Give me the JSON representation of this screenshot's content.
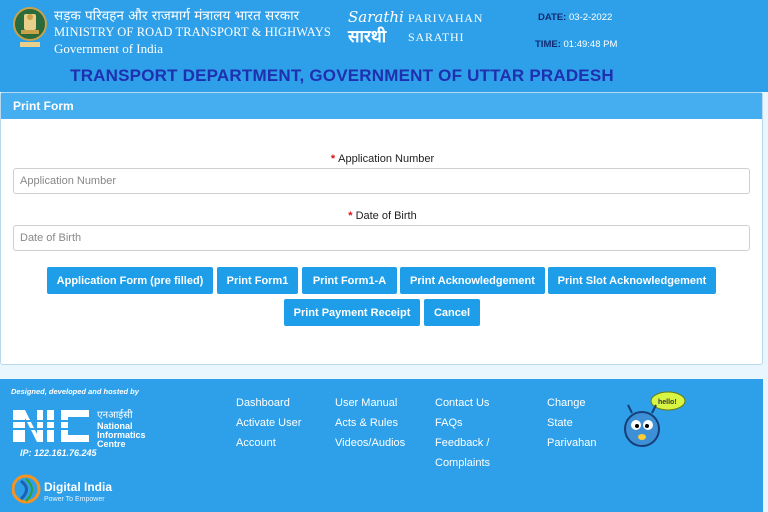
{
  "header": {
    "ministry_hindi": "सड़क परिवहन और राजमार्ग मंत्रालय भारत सरकार",
    "ministry_en": "MINISTRY OF ROAD TRANSPORT & HIGHWAYS",
    "government": "Government of India",
    "parivahan": "PARIVAHAN",
    "sarathi": "SARATHI",
    "date_label": "DATE:",
    "date_value": "03-2-2022",
    "time_label": "TIME:",
    "time_value": "01:49:48 PM",
    "department": "TRANSPORT DEPARTMENT, GOVERNMENT OF UTTAR PRADESH",
    "logo_text": "Sarathi"
  },
  "form": {
    "title": "Print Form",
    "app_no_label": "Application Number",
    "app_no_placeholder": "Application Number",
    "app_no_value": "",
    "dob_label": "Date of Birth",
    "dob_placeholder": "Date of Birth",
    "dob_value": "",
    "required_mark": "*",
    "buttons": {
      "app_form": "Application Form (pre filled)",
      "form1": "Print Form1",
      "form1a": "Print Form1-A",
      "ack": "Print Acknowledgement",
      "slot_ack": "Print Slot Acknowledgement",
      "payment": "Print Payment Receipt",
      "cancel": "Cancel"
    }
  },
  "footer": {
    "designed_by": "Designed, developed and hosted by",
    "nic_hindi": "एनआईसी",
    "nic_line1": "National",
    "nic_line2": "Informatics",
    "nic_line3": "Centre",
    "ip": "IP: 122.161.76.245",
    "digital_india": "Digital India",
    "digital_india_tagline": "Power To Empower",
    "links": {
      "dashboard": "Dashboard",
      "activate_user": "Activate User",
      "account": "Account",
      "user_manual": "User Manual",
      "acts_rules": "Acts & Rules",
      "videos": "Videos/Audios",
      "contact": "Contact Us",
      "faqs": "FAQs",
      "feedback": "Feedback /",
      "complaints": "Complaints",
      "change": "Change",
      "state": "State",
      "parivahan": "Parivahan"
    },
    "mascot_bubble": "hello!"
  },
  "colors": {
    "header_bg": "#2ea0e9",
    "button_bg": "#1e9ee8",
    "department_text": "#1e2fb0",
    "required": "#dd1111"
  }
}
